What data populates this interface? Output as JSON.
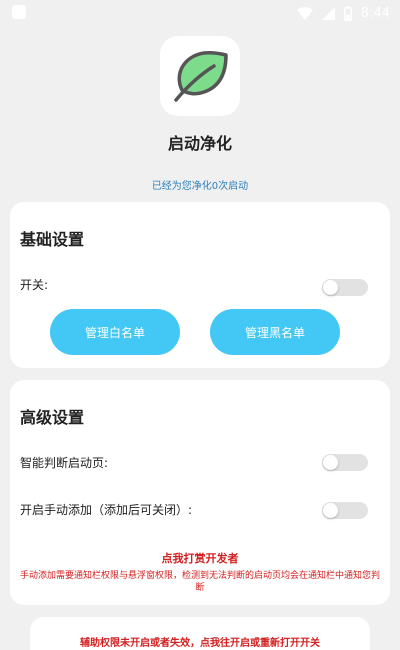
{
  "status_bar": {
    "time": "8:44",
    "icons": [
      "wifi-icon",
      "signal-icon",
      "battery-icon"
    ]
  },
  "app": {
    "icon": "leaf-icon",
    "title": "启动净化",
    "purify_count": "已经为您净化0次启动"
  },
  "basic_settings": {
    "title": "基础设置",
    "switch_label": "开关:",
    "switch_on": false,
    "whitelist_button": "管理白名单",
    "blacklist_button": "管理黑名单"
  },
  "advanced_settings": {
    "title": "高级设置",
    "smart_detect_label": "智能判断启动页:",
    "smart_detect_on": false,
    "manual_add_label": "开启手动添加（添加后可关闭）:",
    "manual_add_on": false,
    "donate_link": "点我打赏开发者",
    "manual_add_note": "手动添加需要通知栏权限与悬浮窗权限，检测到无法判断的启动页均会在通知栏中通知您判断"
  },
  "accessibility_warning": "辅助权限未开启或者失效，点我往开启或重新打开开关",
  "colors": {
    "accent_button": "#43c8f5",
    "info_text": "#2d7fb8",
    "warning_text": "#d32020",
    "leaf_fill": "#7ddc8c",
    "toggle_off": "#e2e2e2"
  }
}
